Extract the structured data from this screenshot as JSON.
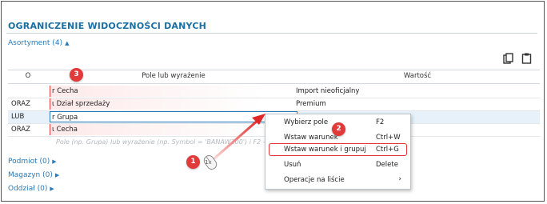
{
  "title": "OGRANICZENIE WIDOCZNOŚCI DANYCH",
  "sections": {
    "asortyment": "Asortyment (4)",
    "podmiot": "Podmiot (0)",
    "magazyn": "Magazyn (0)",
    "oddzial": "Oddział (0)"
  },
  "grid": {
    "headers": {
      "op": "O",
      "expr": "Pole lub wyrażenie",
      "value": "Wartość"
    },
    "rows": [
      {
        "op": "",
        "expr": "r Cecha",
        "value": "Import nieoficjalny"
      },
      {
        "op": "ORAZ",
        "expr": "ι Dział sprzedaży",
        "value": "Premium"
      },
      {
        "op": "LUB",
        "expr": "r Grupa",
        "value": ""
      },
      {
        "op": "ORAZ",
        "expr": "ι Cecha",
        "value": ""
      }
    ],
    "placeholder": "Pole (np. Grupa) lub wyrażenie (np. Symbol = 'BANAW200') i F2 - wybierz"
  },
  "context_menu": {
    "items": [
      {
        "label": "Wybierz pole",
        "shortcut": "F2"
      },
      {
        "label": "Wstaw warunek",
        "shortcut": "Ctrl+W"
      },
      {
        "label": "Wstaw warunek i grupuj",
        "shortcut": "Ctrl+G"
      },
      {
        "label": "Usuń",
        "shortcut": "Delete"
      },
      {
        "label": "Operacje na liście",
        "shortcut": ""
      }
    ]
  },
  "badges": {
    "one": "1",
    "two": "2",
    "three": "3"
  },
  "mouse_label": "1x",
  "colors": {
    "accent": "#1a6fa3",
    "badge": "#e03a3a",
    "highlight": "#e53535",
    "selected_row": "#e6f1fa"
  },
  "icons": [
    "copy-icon",
    "clipboard-icon",
    "mouse-icon",
    "arrow-pointer-icon",
    "chevron-right-icon",
    "triangle-expand-icon"
  ]
}
